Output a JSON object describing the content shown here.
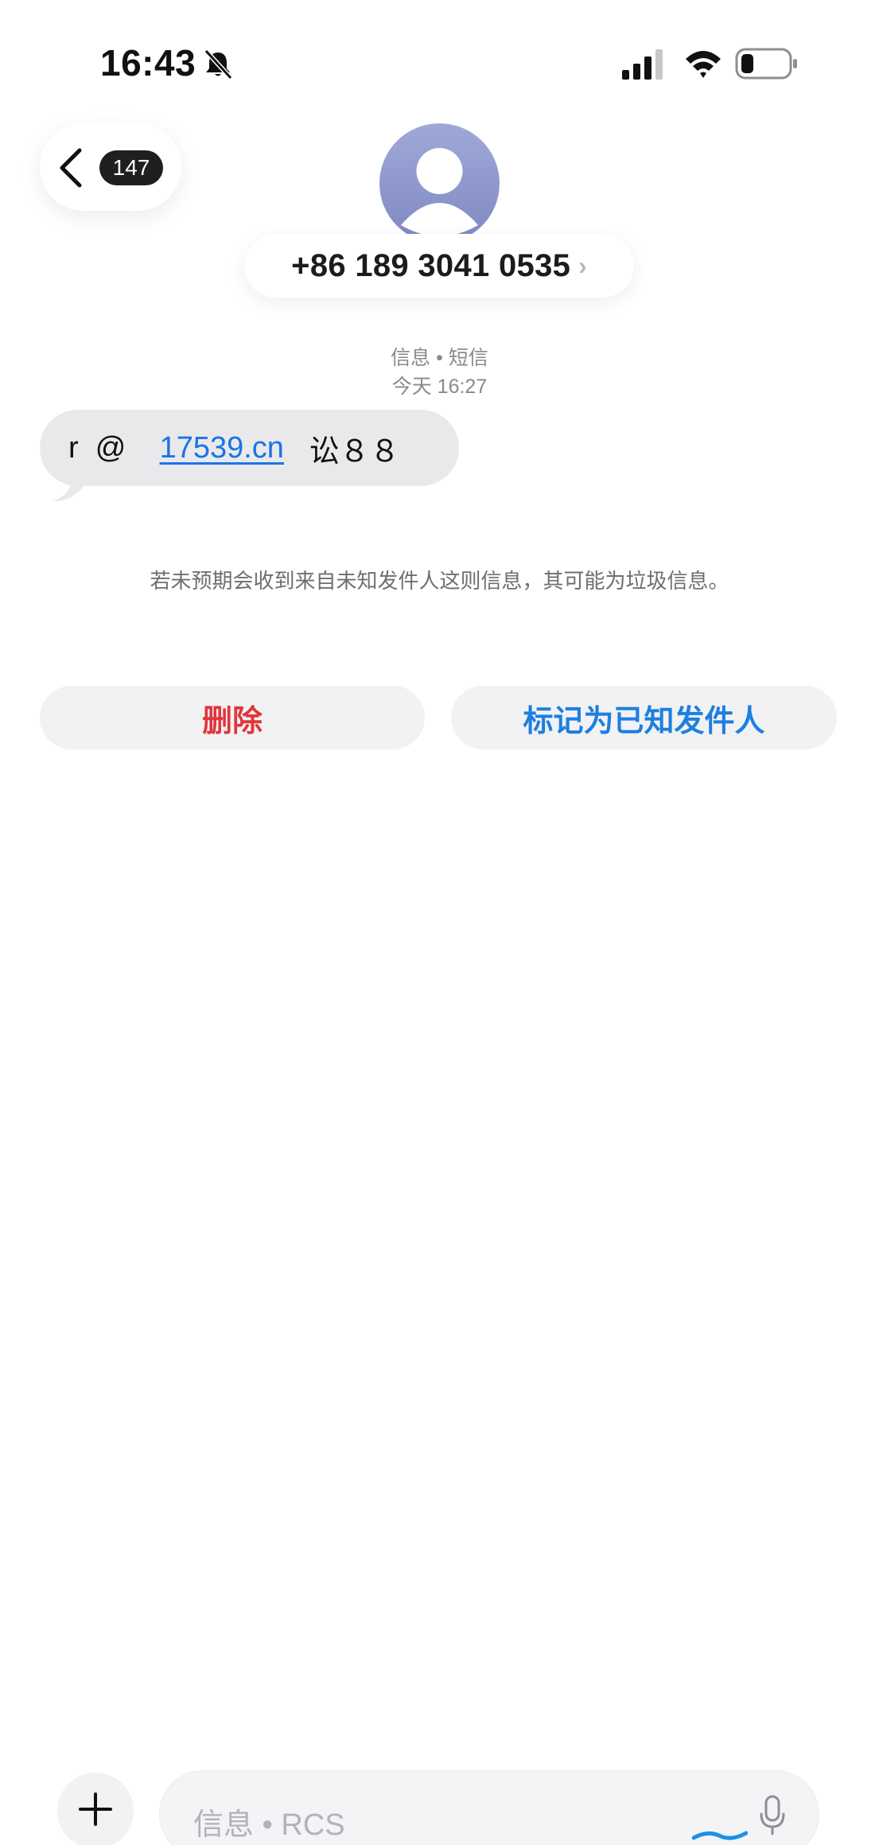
{
  "status_bar": {
    "time": "16:43",
    "bell_icon": "bell-slash-icon",
    "signal_icon": "cellular-signal-icon",
    "wifi_icon": "wifi-icon",
    "battery_icon": "battery-low-icon"
  },
  "header": {
    "back_badge_count": "147",
    "avatar_icon": "person-silhouette-icon",
    "contact_number": "+86 189 3041 0535",
    "contact_chevron": "›"
  },
  "conversation": {
    "service": "信息 • 短信",
    "timestamp": "今天 16:27",
    "message": {
      "part1": "r  @    ",
      "link": "17539.cn",
      "part2": "   讼８８"
    }
  },
  "spam_notice": "若未预期会收到来自未知发件人这则信息，其可能为垃圾信息。",
  "actions": {
    "delete_label": "删除",
    "mark_known_label": "标记为已知发件人"
  },
  "composer": {
    "placeholder": "信息 • RCS",
    "plus_icon": "plus-icon",
    "mic_icon": "microphone-icon"
  },
  "colors": {
    "delete": "#e0363b",
    "mark_known": "#1d7fe0",
    "link": "#1a73e8",
    "bubble": "#e9e9eb",
    "badge": "#1f1f1f"
  }
}
